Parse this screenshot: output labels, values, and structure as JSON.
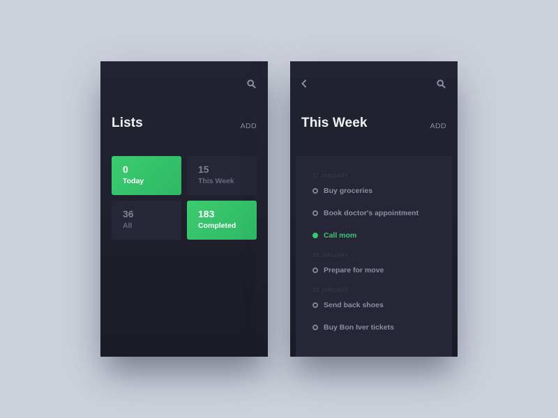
{
  "colors": {
    "accent": "#3cc872",
    "background": "#cdd1dc",
    "panel": "#232333",
    "card": "#262636"
  },
  "lists_screen": {
    "title": "Lists",
    "add_label": "ADD",
    "search_icon": "search-icon",
    "cards": [
      {
        "count": "0",
        "label": "Today",
        "active": true
      },
      {
        "count": "15",
        "label": "This Week",
        "active": false
      },
      {
        "count": "36",
        "label": "All",
        "active": false
      },
      {
        "count": "183",
        "label": "Completed",
        "active": true
      }
    ]
  },
  "week_screen": {
    "title": "This Week",
    "add_label": "ADD",
    "back_icon": "chevron-left-icon",
    "search_icon": "search-icon",
    "sections": [
      {
        "date": "17 JANUARY",
        "tasks": [
          {
            "text": "Buy groceries",
            "done": false
          },
          {
            "text": "Book doctor's appointment",
            "done": false
          },
          {
            "text": "Call mom",
            "done": true
          }
        ]
      },
      {
        "date": "18 JANUARY",
        "tasks": [
          {
            "text": "Prepare for move",
            "done": false
          }
        ]
      },
      {
        "date": "19 JANUARY",
        "tasks": [
          {
            "text": "Send back shoes",
            "done": false
          },
          {
            "text": "Buy Bon Iver tickets",
            "done": false
          }
        ]
      }
    ]
  }
}
